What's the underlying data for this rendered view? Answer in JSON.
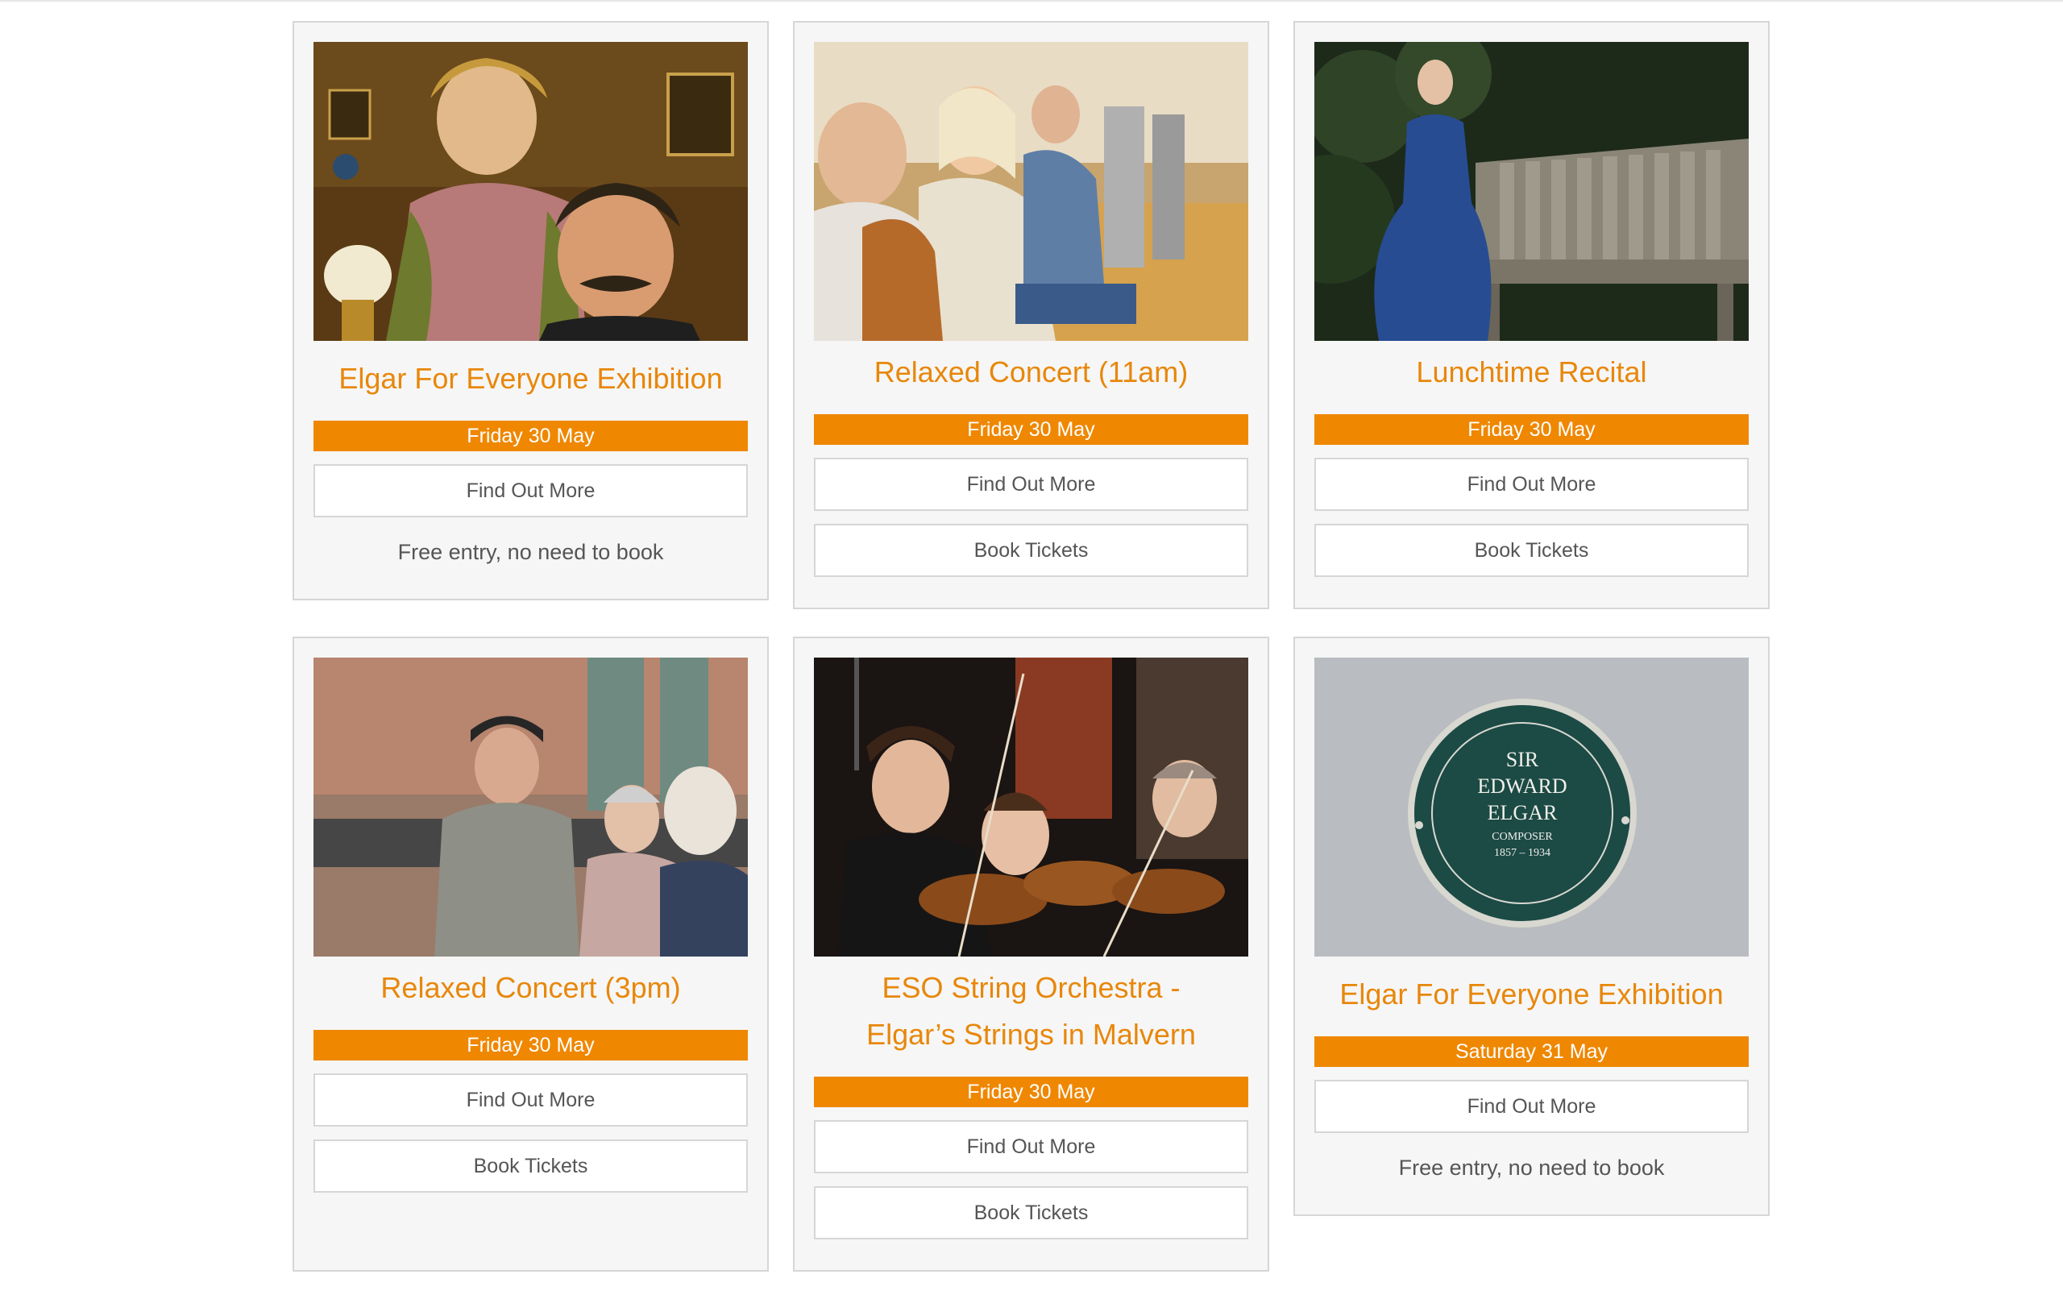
{
  "events": [
    {
      "title": "Elgar For Everyone Exhibition",
      "date": "Friday 30 May",
      "find_out_more": "Find Out More",
      "note": "Free entry, no need to book"
    },
    {
      "title": "Relaxed Concert (11am)",
      "date": "Friday 30 May",
      "find_out_more": "Find Out More",
      "book_tickets": "Book Tickets"
    },
    {
      "title": "Lunchtime Recital",
      "date": "Friday 30 May",
      "find_out_more": "Find Out More",
      "book_tickets": "Book Tickets"
    },
    {
      "title": "Relaxed Concert (3pm)",
      "date": "Friday 30 May",
      "find_out_more": "Find Out More",
      "book_tickets": "Book Tickets"
    },
    {
      "title_line1": "ESO String Orchestra -",
      "title_line2": "Elgar’s Strings in Malvern",
      "date": "Friday 30 May",
      "find_out_more": "Find Out More",
      "book_tickets": "Book Tickets"
    },
    {
      "title": "Elgar For Everyone Exhibition",
      "date": "Saturday 31 May",
      "find_out_more": "Find Out More",
      "note": "Free entry, no need to book"
    }
  ],
  "plaque": {
    "line1": "SIR",
    "line2": "EDWARD",
    "line3": "ELGAR",
    "line4": "COMPOSER",
    "line5": "1857 – 1934"
  },
  "colors": {
    "accent": "#ef8700",
    "title": "#e8870a",
    "border": "#d6d6d6",
    "card_bg": "#f6f6f6"
  }
}
